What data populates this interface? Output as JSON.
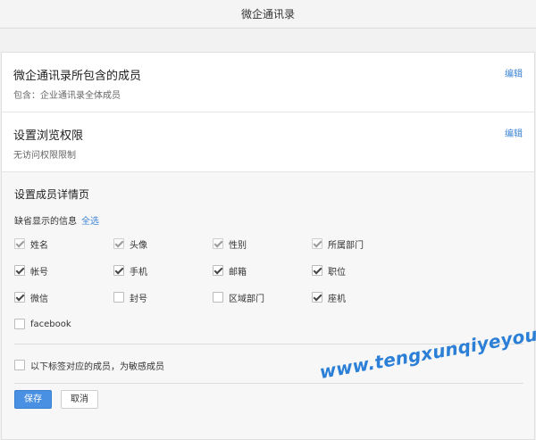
{
  "header": {
    "title": "微企通讯录"
  },
  "members_section": {
    "title": "微企通讯录所包含的成员",
    "description": "包含：企业通讯录全体成员",
    "edit_label": "编辑"
  },
  "permission_section": {
    "title": "设置浏览权限",
    "description": "无访问权限限制",
    "edit_label": "编辑"
  },
  "detail_section": {
    "title": "设置成员详情页",
    "default_label": "缺省显示的信息",
    "select_all_label": "全选",
    "fields": [
      {
        "label": "姓名",
        "checked": true,
        "disabled": true
      },
      {
        "label": "头像",
        "checked": true,
        "disabled": true
      },
      {
        "label": "性别",
        "checked": true,
        "disabled": true
      },
      {
        "label": "所属部门",
        "checked": true,
        "disabled": true
      },
      {
        "label": "帐号",
        "checked": true,
        "disabled": false
      },
      {
        "label": "手机",
        "checked": true,
        "disabled": false
      },
      {
        "label": "邮箱",
        "checked": true,
        "disabled": false
      },
      {
        "label": "职位",
        "checked": true,
        "disabled": false
      },
      {
        "label": "微信",
        "checked": true,
        "disabled": false
      },
      {
        "label": "封号",
        "checked": false,
        "disabled": false
      },
      {
        "label": "区域部门",
        "checked": false,
        "disabled": false
      },
      {
        "label": "座机",
        "checked": true,
        "disabled": false
      },
      {
        "label": "facebook",
        "checked": false,
        "disabled": false
      }
    ],
    "sensitive_label": "以下标签对应的成员，为敏感成员",
    "sensitive_checked": false
  },
  "actions": {
    "save_label": "保存",
    "cancel_label": "取消"
  },
  "watermark": "www.tengxunqiyeyou.com",
  "colors": {
    "link": "#3d84d5",
    "primary_button": "#4a90e2",
    "watermark": "#2b7fd6"
  }
}
